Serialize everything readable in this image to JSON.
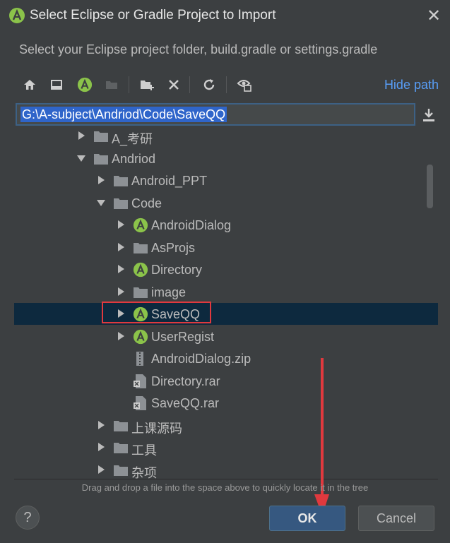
{
  "window": {
    "title": "Select Eclipse or Gradle Project to Import",
    "description": "Select your Eclipse project folder, build.gradle or settings.gradle"
  },
  "toolbar": {
    "hide_path_label": "Hide path",
    "icons": [
      "home-icon",
      "desktop-icon",
      "android-project-icon",
      "module-folder-icon",
      "new-folder-icon",
      "delete-icon",
      "refresh-icon",
      "show-hidden-icon"
    ]
  },
  "path": {
    "value": "G:\\A-subject\\Andriod\\Code\\SaveQQ"
  },
  "tree": {
    "rows": [
      {
        "label": "A_考研",
        "type": "folder",
        "expanded": false
      },
      {
        "label": "Andriod",
        "type": "folder",
        "expanded": true
      },
      {
        "label": "Android_PPT",
        "type": "folder",
        "expanded": false
      },
      {
        "label": "Code",
        "type": "folder",
        "expanded": true
      },
      {
        "label": "AndroidDialog",
        "type": "android-project",
        "expanded": false
      },
      {
        "label": "AsProjs",
        "type": "folder",
        "expanded": false
      },
      {
        "label": "Directory",
        "type": "android-project",
        "expanded": false
      },
      {
        "label": "image",
        "type": "folder",
        "expanded": false
      },
      {
        "label": "SaveQQ",
        "type": "android-project",
        "expanded": false,
        "selected": true
      },
      {
        "label": "UserRegist",
        "type": "android-project",
        "expanded": false
      },
      {
        "label": "AndroidDialog.zip",
        "type": "zip-file"
      },
      {
        "label": "Directory.rar",
        "type": "archive-file"
      },
      {
        "label": "SaveQQ.rar",
        "type": "archive-file"
      },
      {
        "label": "上课源码",
        "type": "folder",
        "expanded": false
      },
      {
        "label": "工具",
        "type": "folder",
        "expanded": false
      },
      {
        "label": "杂项",
        "type": "folder",
        "expanded": false
      }
    ]
  },
  "hint": "Drag and drop a file into the space above to quickly locate it in the tree",
  "buttons": {
    "help": "?",
    "ok": "OK",
    "cancel": "Cancel"
  },
  "colors": {
    "background": "#3c3f41",
    "selection": "#0d293e",
    "link": "#589df6",
    "annotation_red": "#e0393e",
    "android_green": "#8bc34a",
    "folder_gray": "#8d9195"
  }
}
